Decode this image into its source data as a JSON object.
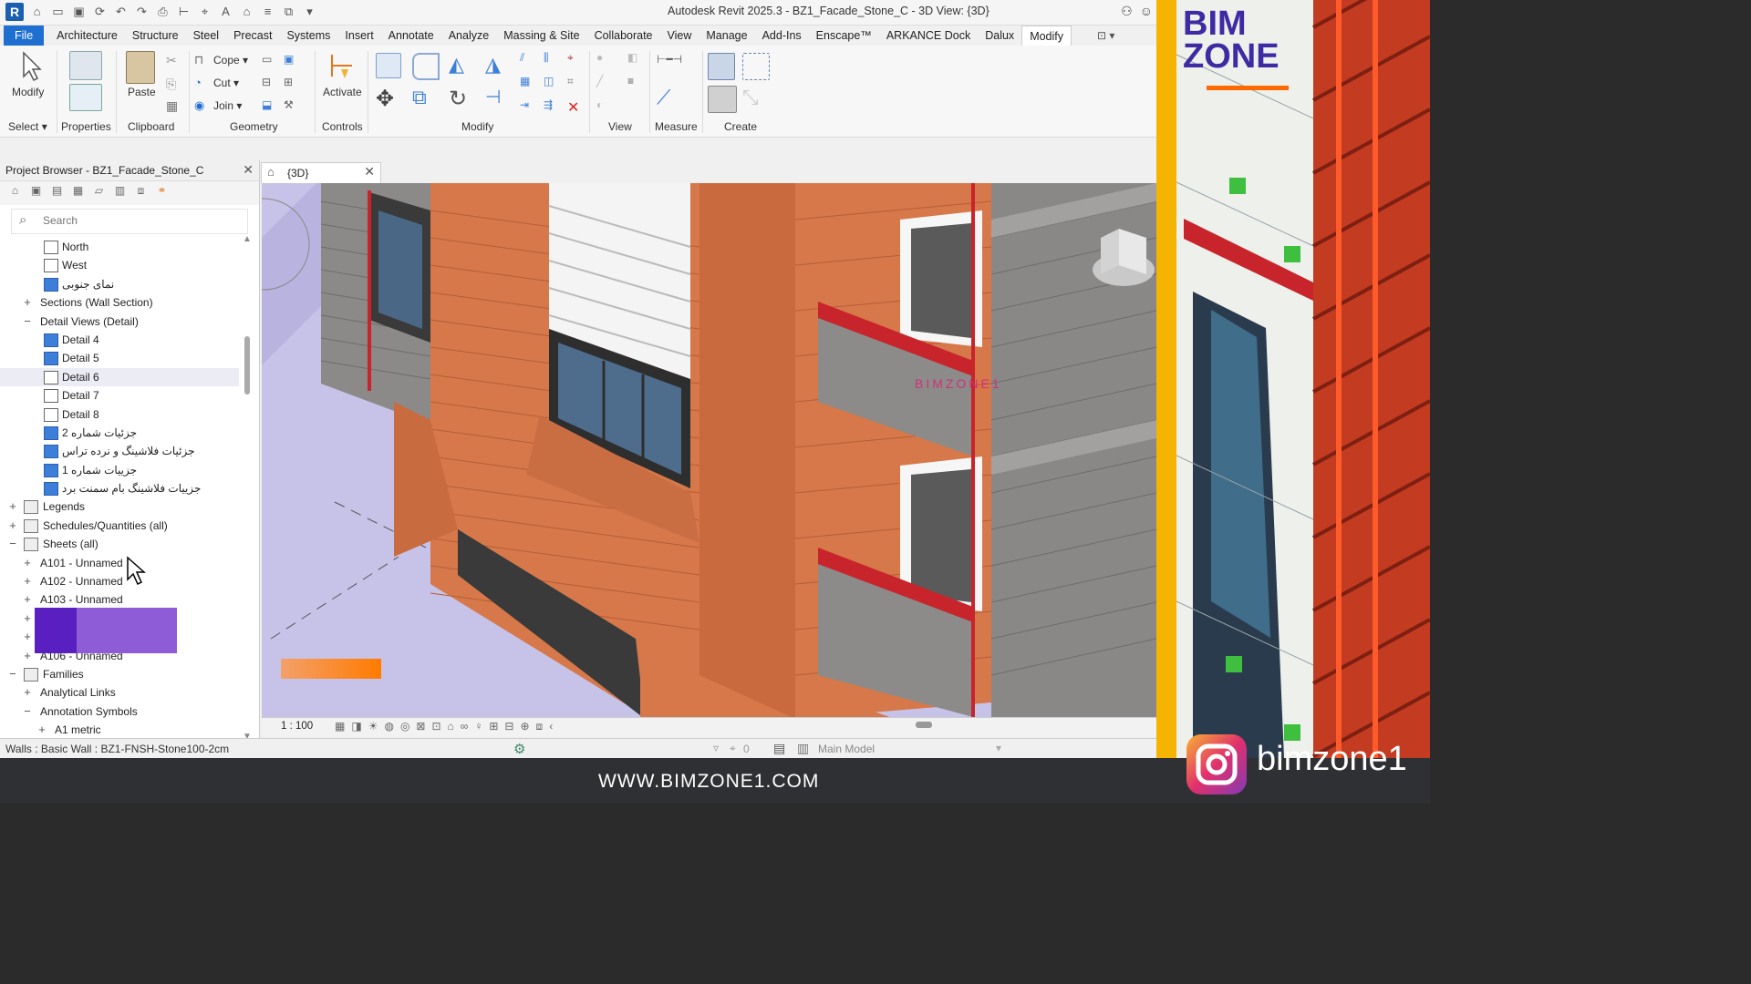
{
  "window": {
    "title": "Autodesk Revit 2025.3 - BZ1_Facade_Stone_C - 3D View: {3D}",
    "app_letter": "R"
  },
  "menu": {
    "items": [
      "File",
      "Architecture",
      "Structure",
      "Steel",
      "Precast",
      "Systems",
      "Insert",
      "Annotate",
      "Analyze",
      "Massing & Site",
      "Collaborate",
      "View",
      "Manage",
      "Add-Ins",
      "Enscape™",
      "ARKANCE Dock",
      "Dalux",
      "Modify"
    ],
    "active": "Modify"
  },
  "ribbon": {
    "modify_label": "Modify",
    "properties_label": "Properties",
    "paste_label": "Paste",
    "cope_label": "Cope",
    "cut_label": "Cut",
    "join_label": "Join",
    "activate_label": "Activate",
    "groups": {
      "select": "Select",
      "properties": "Properties",
      "clipboard": "Clipboard",
      "geometry": "Geometry",
      "controls": "Controls",
      "modify": "Modify",
      "view": "View",
      "measure": "Measure",
      "create": "Create"
    }
  },
  "project_browser": {
    "title": "Project Browser - BZ1_Facade_Stone_C",
    "search_placeholder": "Search",
    "tree": [
      {
        "label": "North",
        "indent": 2,
        "type": "view"
      },
      {
        "label": "West",
        "indent": 2,
        "type": "view"
      },
      {
        "label": "نمای جنوبی",
        "indent": 2,
        "type": "view-sel"
      },
      {
        "label": "Sections (Wall Section)",
        "indent": 1,
        "toggle": "+"
      },
      {
        "label": "Detail Views (Detail)",
        "indent": 1,
        "toggle": "−"
      },
      {
        "label": "Detail 4",
        "indent": 2,
        "type": "view-sel"
      },
      {
        "label": "Detail 5",
        "indent": 2,
        "type": "view-sel"
      },
      {
        "label": "Detail 6",
        "indent": 2,
        "type": "view",
        "highlight": true
      },
      {
        "label": "Detail 7",
        "indent": 2,
        "type": "view"
      },
      {
        "label": "Detail 8",
        "indent": 2,
        "type": "view"
      },
      {
        "label": "جزئیات شماره 2",
        "indent": 2,
        "type": "view-sel"
      },
      {
        "label": "جزئیات فلاشینگ و نرده تراس",
        "indent": 2,
        "type": "view-sel"
      },
      {
        "label": "جزییات شماره 1",
        "indent": 2,
        "type": "view-sel"
      },
      {
        "label": "جزییات فلاشینگ بام سمنت برد",
        "indent": 2,
        "type": "view-sel"
      },
      {
        "label": "Legends",
        "indent": 0,
        "toggle": "+",
        "type": "folder"
      },
      {
        "label": "Schedules/Quantities (all)",
        "indent": 0,
        "toggle": "+",
        "type": "folder"
      },
      {
        "label": "Sheets (all)",
        "indent": 0,
        "toggle": "−",
        "type": "folder"
      },
      {
        "label": "A101 - Unnamed",
        "indent": 1,
        "toggle": "+"
      },
      {
        "label": "A102 - Unnamed",
        "indent": 1,
        "toggle": "+"
      },
      {
        "label": "A103 - Unnamed",
        "indent": 1,
        "toggle": "+"
      },
      {
        "label": "",
        "indent": 1,
        "toggle": "+"
      },
      {
        "label": "",
        "indent": 1,
        "toggle": "+"
      },
      {
        "label": "A106 - Unnamed",
        "indent": 1,
        "toggle": "+"
      },
      {
        "label": "Families",
        "indent": 0,
        "toggle": "−",
        "type": "folder"
      },
      {
        "label": "Analytical Links",
        "indent": 1,
        "toggle": "+"
      },
      {
        "label": "Annotation Symbols",
        "indent": 1,
        "toggle": "−"
      },
      {
        "label": "A1 metric",
        "indent": 2,
        "toggle": "+"
      }
    ]
  },
  "view_tab": {
    "title": "{3D}"
  },
  "view_watermark": "BIMZONE1",
  "view_bar": {
    "scale": "1 : 100"
  },
  "status": {
    "text": "Walls : Basic Wall : BZ1-FNSH-Stone100-2cm",
    "model": "Main Model",
    "count": "0"
  },
  "website": "WWW.BIMZONE1.COM",
  "brand": {
    "line1": "BIM",
    "line2": "ZONE"
  },
  "instagram_handle": "bimzone1",
  "colors": {
    "file_tab": "#1f6fd1",
    "brick": "#d6784a",
    "block": "#8c8c8c",
    "red_trim": "#c8242b",
    "brand_purple": "#3e2aa3",
    "brand_orange": "#ff6a00"
  }
}
